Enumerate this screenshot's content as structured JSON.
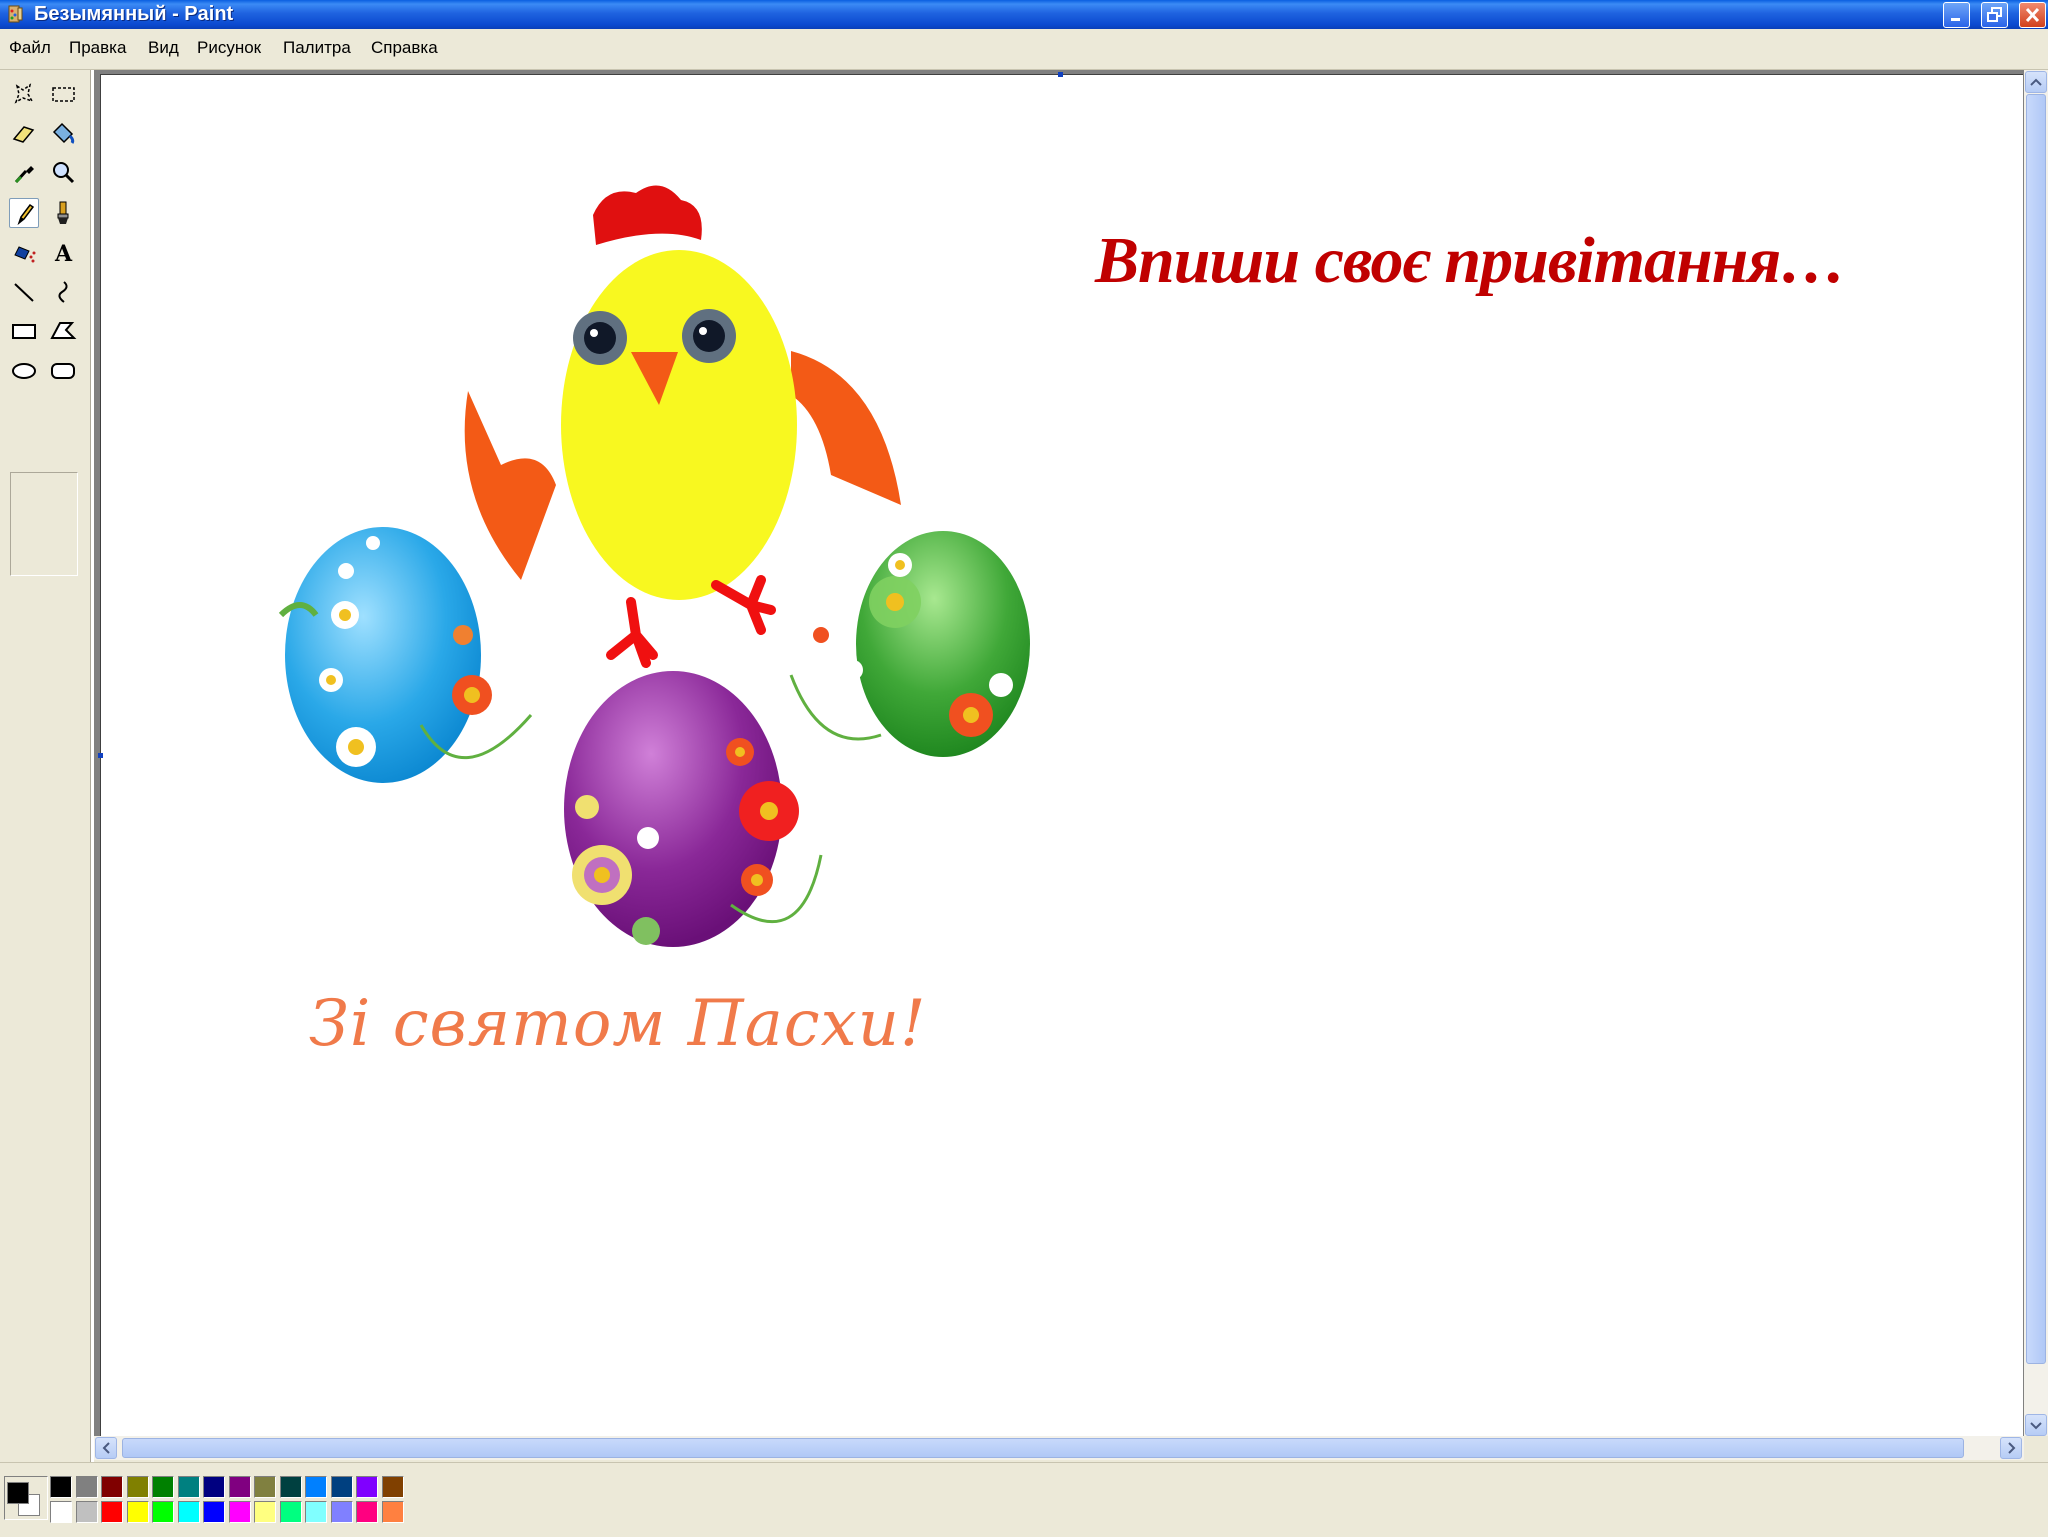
{
  "window": {
    "title": "Безымянный - Paint"
  },
  "menu": [
    "Файл",
    "Правка",
    "Вид",
    "Рисунок",
    "Палитра",
    "Справка"
  ],
  "tools": [
    {
      "icon": "free-select-icon"
    },
    {
      "icon": "rect-select-icon"
    },
    {
      "icon": "eraser-icon"
    },
    {
      "icon": "fill-bucket-icon"
    },
    {
      "icon": "color-picker-icon"
    },
    {
      "icon": "magnifier-icon"
    },
    {
      "icon": "pencil-icon",
      "selected": true
    },
    {
      "icon": "brush-icon"
    },
    {
      "icon": "airbrush-icon"
    },
    {
      "icon": "text-icon"
    },
    {
      "icon": "line-icon"
    },
    {
      "icon": "curve-icon"
    },
    {
      "icon": "rectangle-icon"
    },
    {
      "icon": "polygon-icon"
    },
    {
      "icon": "ellipse-icon"
    },
    {
      "icon": "rounded-rect-icon"
    }
  ],
  "canvas": {
    "greeting": "Впиши своє привітання…",
    "easter_text": "Зі святом Пасхи!"
  },
  "colors": {
    "foreground": "#000000",
    "background": "#ffffff",
    "palette_top": [
      "#000000",
      "#808080",
      "#800000",
      "#808000",
      "#008000",
      "#008080",
      "#000080",
      "#800080",
      "#808040",
      "#004040",
      "#0080ff",
      "#004080",
      "#8000ff",
      "#804000"
    ],
    "palette_bottom": [
      "#ffffff",
      "#c0c0c0",
      "#ff0000",
      "#ffff00",
      "#00ff00",
      "#00ffff",
      "#0000ff",
      "#ff00ff",
      "#ffff80",
      "#00ff80",
      "#80ffff",
      "#8080ff",
      "#ff0080",
      "#ff8040"
    ]
  }
}
